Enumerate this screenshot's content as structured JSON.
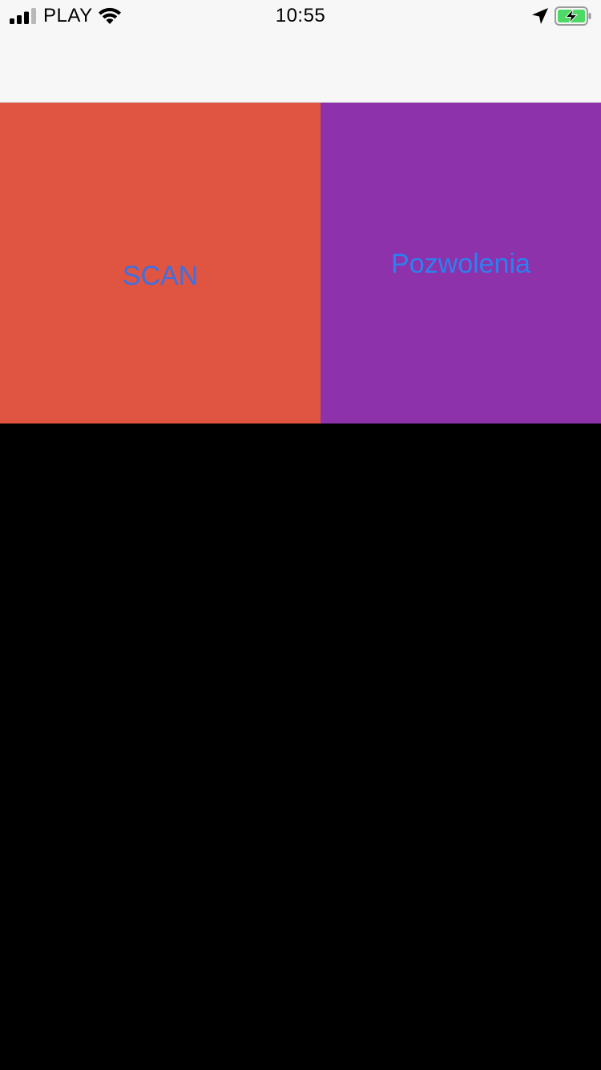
{
  "status_bar": {
    "carrier": "PLAY",
    "time": "10:55",
    "signal_icon": "cellular-signal-icon",
    "wifi_icon": "wifi-icon",
    "location_icon": "location-arrow-icon",
    "battery_icon": "battery-charging-icon",
    "battery_color": "#4cd964"
  },
  "tiles": {
    "scan": {
      "label": "SCAN",
      "background": "#e05541",
      "text_color": "#3f6fe0"
    },
    "permissions": {
      "label": "Pozwolenia",
      "background": "#8d32aa",
      "text_color": "#2c80f0"
    }
  },
  "colors": {
    "bar_background": "#f7f7f7",
    "content_background": "#000000"
  }
}
